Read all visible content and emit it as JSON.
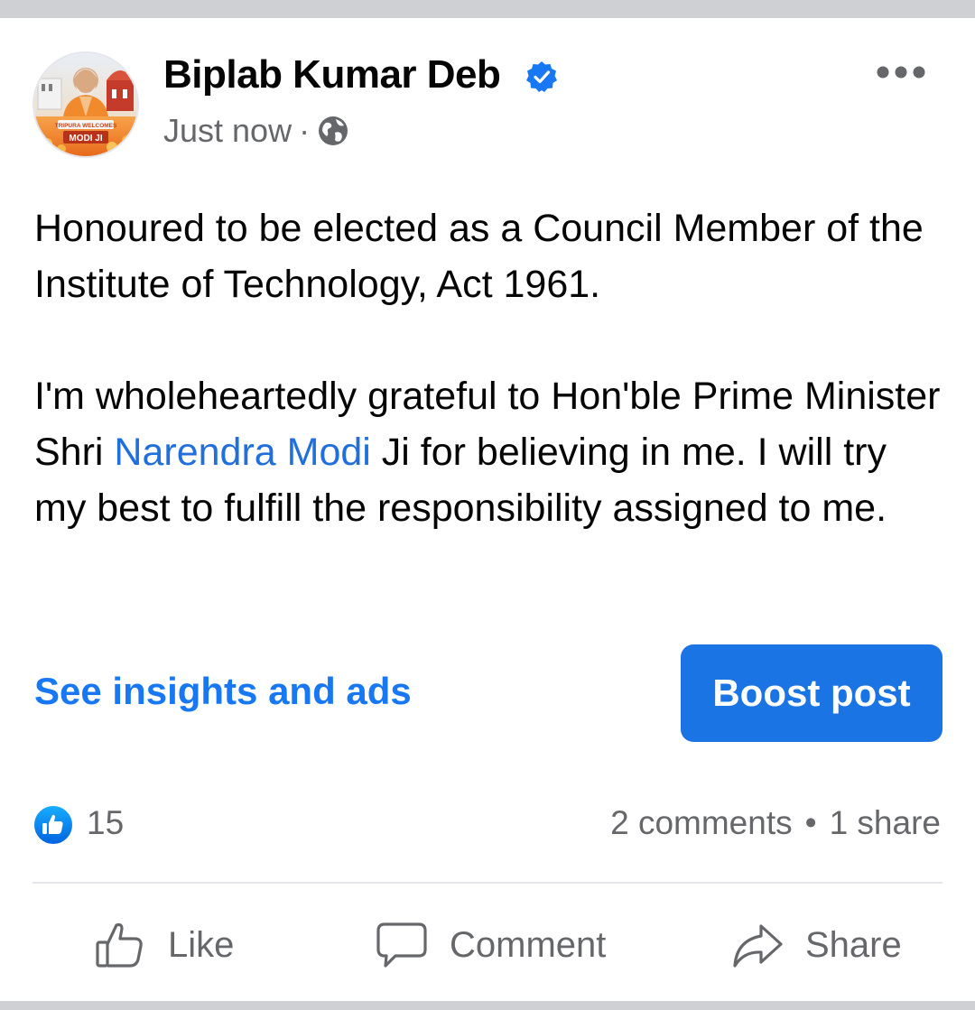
{
  "post": {
    "author": "Biplab Kumar Deb",
    "timestamp": "Just now",
    "separator": "·",
    "avatar_caption_top": "TRIPURA WELCOMES",
    "avatar_caption_bottom": "MODI JI",
    "paragraph1": "Honoured to be elected as a Council Member of the Institute of Technology, Act 1961.",
    "paragraph2_before": "I'm wholeheartedly grateful to Hon'ble Prime Minister Shri ",
    "paragraph2_mention": "Narendra Modi",
    "paragraph2_after": " Ji for believing in me. I will try my best to fulfill the responsibility assigned to me."
  },
  "promo": {
    "insights_label": "See insights and ads",
    "boost_label": "Boost post"
  },
  "stats": {
    "reactions": "15",
    "comments": "2 comments",
    "separator": "•",
    "shares": "1 share"
  },
  "actions": {
    "like": "Like",
    "comment": "Comment",
    "share": "Share"
  },
  "icons": {
    "verified": "verified-badge-icon",
    "audience": "globe-icon",
    "menu": "more-options-icon",
    "reaction": "like-reaction-icon"
  },
  "colors": {
    "accent": "#1877f2",
    "mention": "#216fdb",
    "button": "#1b74e4",
    "secondary_text": "#65676b",
    "separator_bar": "#ced0d4"
  }
}
